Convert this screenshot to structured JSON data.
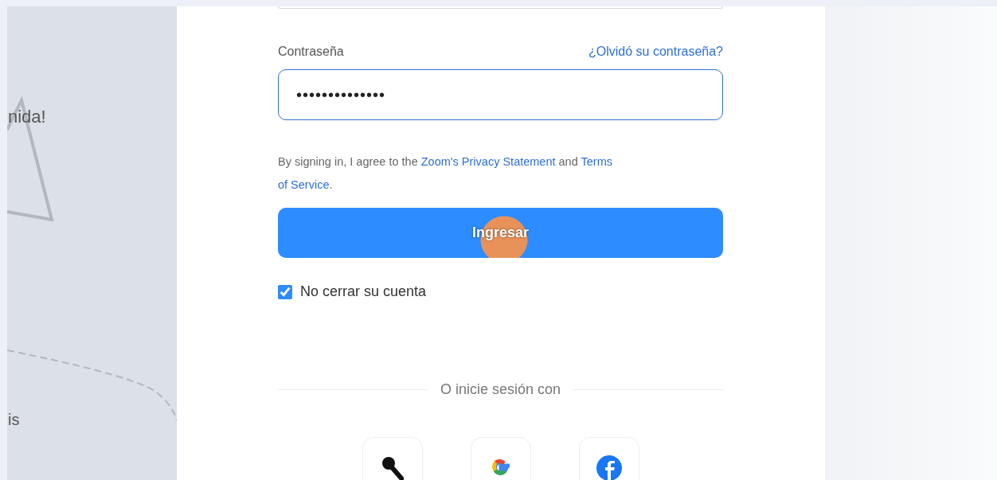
{
  "left_panel": {
    "texts": [
      "nida!",
      "is"
    ]
  },
  "password": {
    "label": "Contraseña",
    "forgot_link": "¿Olvidó su contraseña?",
    "value": "••••••••••••••"
  },
  "agreement": {
    "before": "By signing in, I agree to the",
    "privacy_link": "Zoom's Privacy Statement",
    "middle": "and",
    "terms_link_line1": "Terms",
    "terms_link_line2": "of Service",
    "end": "."
  },
  "sign_in_button": {
    "label": "Ingresar"
  },
  "keep_signed_in": {
    "label": "No cerrar su cuenta",
    "checked": true
  },
  "divider_text": "O inicie sesión con",
  "social": [
    {
      "kind": "sso"
    },
    {
      "kind": "google"
    },
    {
      "kind": "facebook"
    }
  ]
}
